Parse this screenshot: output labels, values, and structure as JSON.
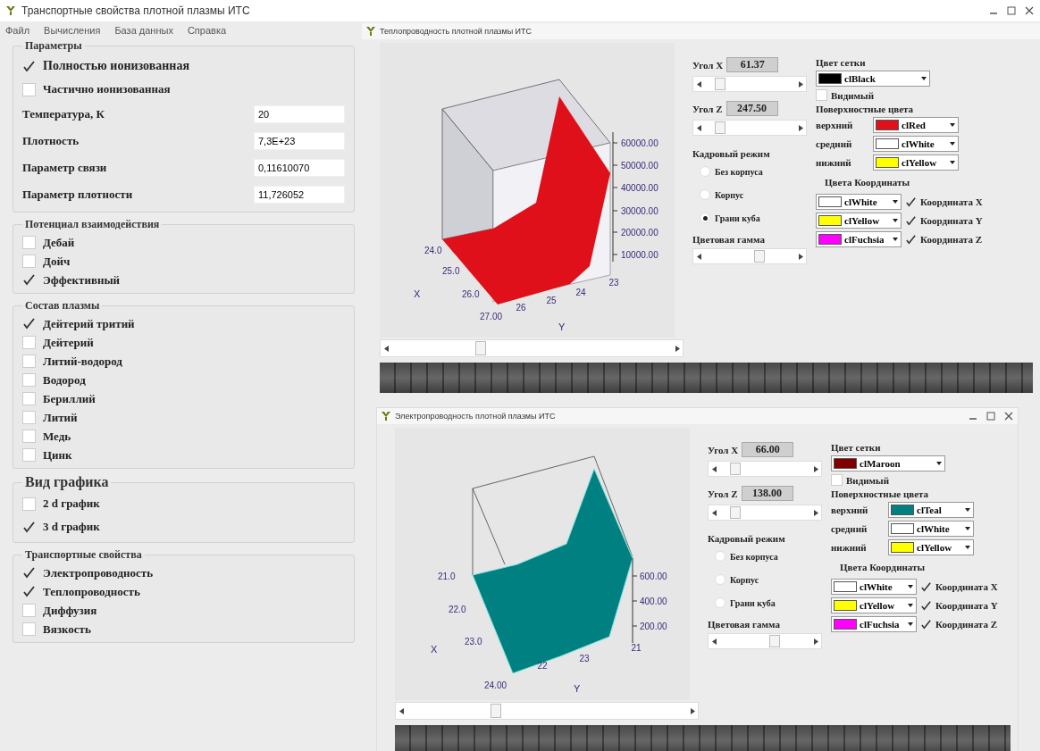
{
  "window": {
    "title": "Транспортные свойства плотной плазмы ИТС"
  },
  "menu": [
    "Файл",
    "Вычисления",
    "База данных",
    "Справка"
  ],
  "parameters": {
    "title": "Параметры",
    "options": [
      {
        "label": "Полностью ионизованная",
        "checked": true
      },
      {
        "label": "Частично ионизованная",
        "checked": false
      }
    ],
    "fields": [
      {
        "label": "Температура, К",
        "value": "20"
      },
      {
        "label": "Плотность",
        "value": "7,3Е+23"
      },
      {
        "label": "Параметр связи",
        "value": "0,11610070"
      },
      {
        "label": "Параметр плотности",
        "value": "11,726052"
      }
    ]
  },
  "groups": [
    {
      "title": "Потенциал взаимодействия",
      "options": [
        {
          "label": "Дебай",
          "checked": false
        },
        {
          "label": "Дойч",
          "checked": false
        },
        {
          "label": "Эффективный",
          "checked": true
        }
      ]
    },
    {
      "title": "Состав плазмы",
      "options": [
        {
          "label": "Дейтерий тритий",
          "checked": true
        },
        {
          "label": "Дейтерий",
          "checked": false
        },
        {
          "label": "Литий-водород",
          "checked": false
        },
        {
          "label": "Водород",
          "checked": false
        },
        {
          "label": "Бериллий",
          "checked": false
        },
        {
          "label": "Литий",
          "checked": false
        },
        {
          "label": "Медь",
          "checked": false
        },
        {
          "label": "Цинк",
          "checked": false
        }
      ]
    },
    {
      "title": "Вид графика",
      "options": [
        {
          "label": "2 d график",
          "checked": false
        },
        {
          "label": "3 d график",
          "checked": true
        }
      ]
    },
    {
      "title": "Транспортные свойства",
      "options": [
        {
          "label": "Электропроводность",
          "checked": true
        },
        {
          "label": "Теплопроводность",
          "checked": true
        },
        {
          "label": "Диффузия",
          "checked": false
        },
        {
          "label": "Вязкость",
          "checked": false
        }
      ]
    }
  ],
  "chart_windows": [
    {
      "title": "Теплопроводность плотной плазмы ИТС",
      "maximized": true,
      "angles": [
        {
          "label": "Угол X",
          "value": "61.37"
        },
        {
          "label": "Угол Z",
          "value": "247.50"
        }
      ],
      "frame_title": "Кадровый режим",
      "frame_modes": [
        {
          "label": "Без корпуса",
          "selected": false
        },
        {
          "label": "Корпус",
          "selected": false
        },
        {
          "label": "Грани куба",
          "selected": true
        }
      ],
      "gamma_label": "Цветовая гамма",
      "grid_title": "Цвет сетки",
      "grid_color": {
        "name": "clBlack",
        "color": "#000000"
      },
      "visible": {
        "label": "Видимый",
        "checked": false
      },
      "surface_title": "Поверхностные цвета",
      "surface": [
        {
          "label": "верхний",
          "name": "clRed",
          "color": "#e0101a"
        },
        {
          "label": "средний",
          "name": "clWhite",
          "color": "#ffffff"
        },
        {
          "label": "нижний",
          "name": "clYellow",
          "color": "#ffff00"
        }
      ],
      "coords_title": "Цвета Координаты",
      "coords": [
        {
          "name": "clWhite",
          "color": "#ffffff",
          "label": "Координата X",
          "checked": true
        },
        {
          "name": "clYellow",
          "color": "#ffff00",
          "label": "Координата Y",
          "checked": true
        },
        {
          "name": "clFuchsia",
          "color": "#ff00ff",
          "label": "Координата Z",
          "checked": true
        }
      ],
      "z_ticks": [
        "60000.00",
        "50000.00",
        "40000.00",
        "30000.00",
        "20000.00",
        "10000.00"
      ],
      "x_ticks": [
        "24.0",
        "25.0",
        "26.0",
        "27.00"
      ],
      "x_axis": "X",
      "y_ticks": [
        "26",
        "25",
        "24",
        "23"
      ],
      "y_axis": "Y"
    },
    {
      "title": "Электропроводность плотной плазмы ИТС",
      "maximized": false,
      "angles": [
        {
          "label": "Угол X",
          "value": "66.00"
        },
        {
          "label": "Угол Z",
          "value": "138.00"
        }
      ],
      "frame_title": "Кадровый режим",
      "frame_modes": [
        {
          "label": "Без корпуса",
          "selected": false
        },
        {
          "label": "Корпус",
          "selected": false
        },
        {
          "label": "Грани куба",
          "selected": false
        }
      ],
      "gamma_label": "Цветовая гамма",
      "grid_title": "Цвет сетки",
      "grid_color": {
        "name": "clMaroon",
        "color": "#800000"
      },
      "visible": {
        "label": "Видимый",
        "checked": false
      },
      "surface_title": "Поверхностные цвета",
      "surface": [
        {
          "label": "верхний",
          "name": "clTeal",
          "color": "#008080"
        },
        {
          "label": "средний",
          "name": "clWhite",
          "color": "#ffffff"
        },
        {
          "label": "нижний",
          "name": "clYellow",
          "color": "#ffff00"
        }
      ],
      "coords_title": "Цвета Координаты",
      "coords": [
        {
          "name": "clWhite",
          "color": "#ffffff",
          "label": "Координата X",
          "checked": true
        },
        {
          "name": "clYellow",
          "color": "#ffff00",
          "label": "Координата Y",
          "checked": true
        },
        {
          "name": "clFuchsia",
          "color": "#ff00ff",
          "label": "Координата Z",
          "checked": true
        }
      ],
      "z_ticks": [
        "600.00",
        "400.00",
        "200.00"
      ],
      "x_ticks": [
        "21.0",
        "22.0",
        "23.0",
        "24.00"
      ],
      "x_axis": "X",
      "y_ticks": [
        "22",
        "23",
        "21"
      ],
      "y_axis": "Y"
    }
  ]
}
